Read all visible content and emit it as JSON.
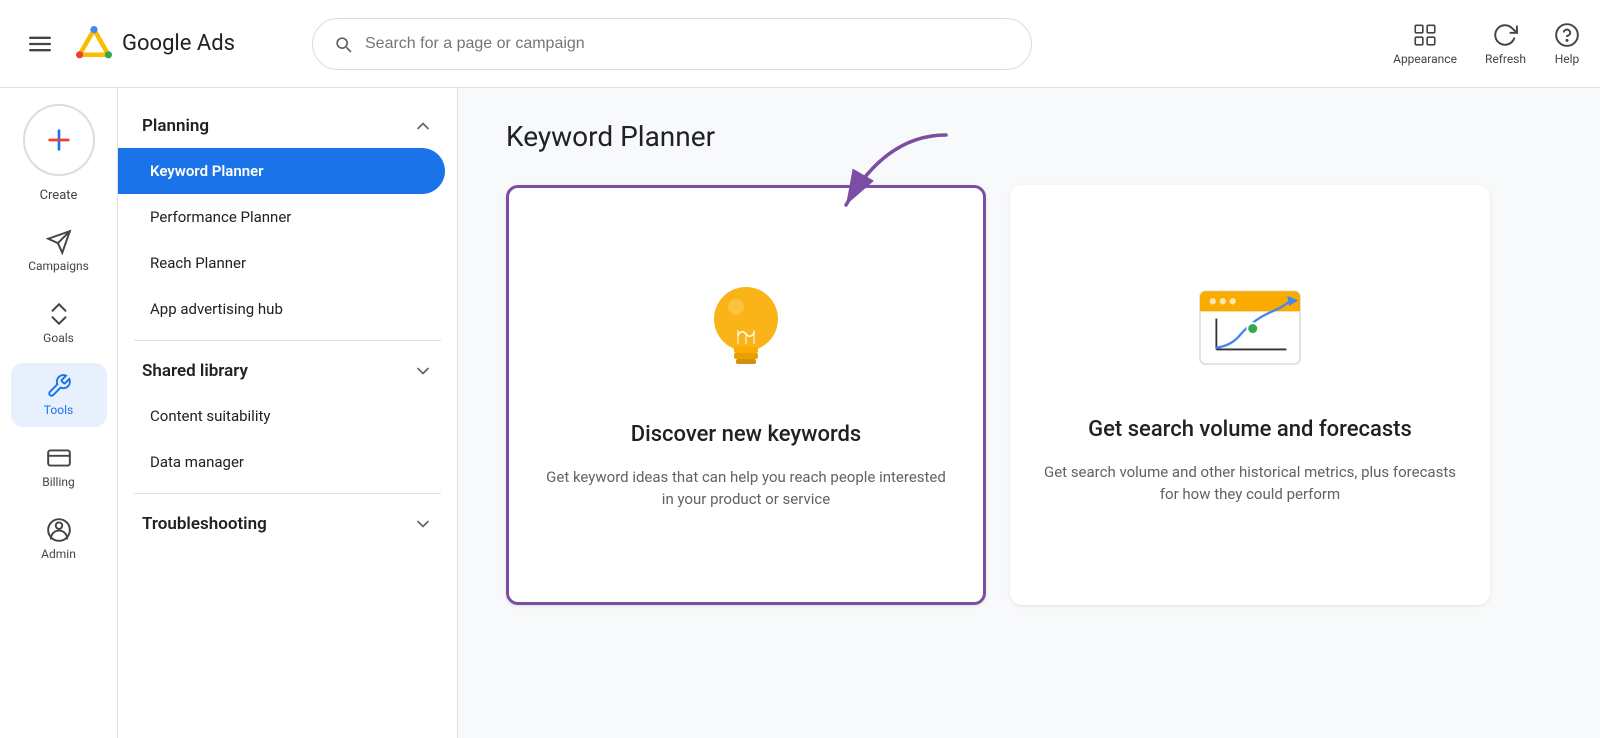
{
  "app": {
    "name": "Google Ads"
  },
  "header": {
    "search_placeholder": "Search for a page or campaign",
    "appearance_label": "Appearance",
    "refresh_label": "Refresh",
    "help_label": "Help"
  },
  "sidebar": {
    "create_label": "Create",
    "items": [
      {
        "id": "campaigns",
        "label": "Campaigns",
        "icon": "campaigns-icon"
      },
      {
        "id": "goals",
        "label": "Goals",
        "icon": "goals-icon"
      },
      {
        "id": "tools",
        "label": "Tools",
        "icon": "tools-icon",
        "active": true
      },
      {
        "id": "billing",
        "label": "Billing",
        "icon": "billing-icon"
      },
      {
        "id": "admin",
        "label": "Admin",
        "icon": "admin-icon"
      }
    ]
  },
  "sub_nav": {
    "sections": [
      {
        "id": "planning",
        "label": "Planning",
        "expanded": true,
        "items": [
          {
            "id": "keyword-planner",
            "label": "Keyword Planner",
            "active": true
          },
          {
            "id": "performance-planner",
            "label": "Performance Planner"
          },
          {
            "id": "reach-planner",
            "label": "Reach Planner"
          },
          {
            "id": "app-advertising-hub",
            "label": "App advertising hub"
          }
        ]
      },
      {
        "id": "shared-library",
        "label": "Shared library",
        "expanded": false,
        "items": [
          {
            "id": "content-suitability",
            "label": "Content suitability"
          },
          {
            "id": "data-manager",
            "label": "Data manager"
          }
        ]
      },
      {
        "id": "troubleshooting",
        "label": "Troubleshooting",
        "expanded": false,
        "items": []
      }
    ]
  },
  "content": {
    "page_title": "Keyword Planner",
    "cards": [
      {
        "id": "discover-keywords",
        "title": "Discover new keywords",
        "description": "Get keyword ideas that can help you reach people interested in your product or service",
        "highlighted": true
      },
      {
        "id": "search-volume",
        "title": "Get search volume and forecasts",
        "description": "Get search volume and other historical metrics, plus forecasts for how they could perform",
        "highlighted": false
      }
    ]
  }
}
